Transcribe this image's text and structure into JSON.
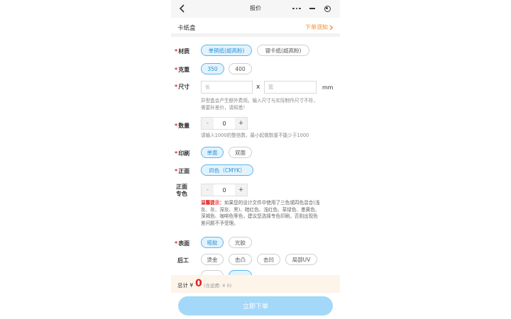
{
  "navbar": {
    "title": "报价"
  },
  "product": {
    "name": "卡纸盒",
    "notice": "下单须知"
  },
  "material": {
    "label": "材质",
    "options": [
      "单铜纸(超高粉)",
      "银卡纸(超高粉)"
    ],
    "selected_index": 0
  },
  "weight": {
    "label": "克重",
    "options": [
      "350",
      "400"
    ],
    "selected_index": 0
  },
  "size": {
    "label": "尺寸",
    "length_placeholder": "长",
    "width_placeholder": "宽",
    "separator": "x",
    "unit": "mm",
    "hint_line1": "异型盒会产生额外费用。输入尺寸与实际制作尺寸不符，",
    "hint_line2": "需要补差价，请知悉！"
  },
  "quantity": {
    "label": "数量",
    "minus": "-",
    "value": "0",
    "plus": "+",
    "hint": "请输入1000的整倍数，最小起做数量不能少于1000"
  },
  "print": {
    "label": "印刷",
    "options": [
      "单面",
      "双面"
    ],
    "selected_index": 0
  },
  "front": {
    "label": "正面",
    "options": [
      "四色（CMYK）"
    ],
    "selected_index": 0
  },
  "spot_color": {
    "label_line1": "正面",
    "label_line2": "专色",
    "minus": "-",
    "value": "0",
    "plus": "+"
  },
  "warning": {
    "title": "温馨提示：",
    "line1": "如果您的设计文件中使用了三色或四色混合(浅",
    "line2": "灰、灰、深灰、黑)、暗红色、浅红色、草绿色、墨黄色、",
    "line3": "深褐色、咖啡色等色，建议您选择专色印刷，否则出现色",
    "line4": "差问题不予受理。"
  },
  "surface": {
    "label": "表面",
    "options": [
      "哑胶",
      "光胶"
    ],
    "selected_index": 0
  },
  "finishing": {
    "label": "后工",
    "options": [
      "烫金",
      "击凸",
      "击凹",
      "局部UV"
    ],
    "row2_options": [
      "",
      ""
    ]
  },
  "total": {
    "label": "总计 ¥",
    "amount": "0",
    "sub": "(含运费: ¥ 0)"
  },
  "submit": {
    "label": "立即下单"
  },
  "colors": {
    "accent": "#2a93d9",
    "accent_bg": "#e3f3fd",
    "required": "#e02020",
    "notice": "#f08a2a",
    "submit_bg": "#a4d8f8"
  }
}
